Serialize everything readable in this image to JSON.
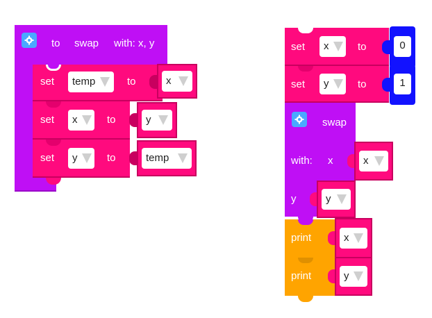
{
  "func_def": {
    "to": "to",
    "name": "swap",
    "params": "with: x, y",
    "rows": [
      {
        "set": "set",
        "var": "temp",
        "to": "to",
        "value": "x"
      },
      {
        "set": "set",
        "var": "x",
        "to": "to",
        "value": "y"
      },
      {
        "set": "set",
        "var": "y",
        "to": "to",
        "value": "temp"
      }
    ]
  },
  "main": {
    "assigns": [
      {
        "set": "set",
        "var": "x",
        "to": "to",
        "value": "0"
      },
      {
        "set": "set",
        "var": "y",
        "to": "to",
        "value": "1"
      }
    ],
    "call": {
      "name": "swap",
      "with": "with:",
      "param_x": "x",
      "arg_x": "x",
      "param_y": "y",
      "arg_y": "y"
    },
    "prints": [
      {
        "label": "print",
        "value": "x"
      },
      {
        "label": "print",
        "value": "y"
      }
    ]
  },
  "colors": {
    "procedure": "#bf0ff5",
    "variable": "#ff0a7e",
    "number": "#1212ff",
    "print": "#ffa400",
    "gear": "#4aa8ff"
  },
  "icons": {
    "settings": "gear-icon",
    "dropdown": "dropdown-triangle-icon"
  }
}
